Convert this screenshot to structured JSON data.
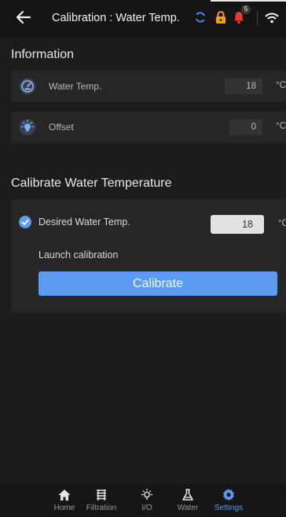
{
  "header": {
    "title": "Calibration : Water Temp.",
    "notification_count": "5"
  },
  "info": {
    "section_title": "Information",
    "water_temp": {
      "label": "Water Temp.",
      "value": "18",
      "unit": "°C"
    },
    "offset": {
      "label": "Offset",
      "value": "0",
      "unit": "°C"
    }
  },
  "calibrate": {
    "section_title": "Calibrate Water Temperature",
    "desired_label": "Desired Water Temp.",
    "desired_value": "18",
    "desired_unit": "°C",
    "launch_label": "Launch calibration",
    "button_label": "Calibrate"
  },
  "nav": [
    {
      "label": "Home"
    },
    {
      "label": "Filtration"
    },
    {
      "label": "I/O"
    },
    {
      "label": "Water"
    },
    {
      "label": "Settings"
    }
  ],
  "colors": {
    "accent": "#5b9bf1",
    "alert": "#e63a35",
    "lock": "#f0a30a",
    "sync": "#3f86f0"
  }
}
